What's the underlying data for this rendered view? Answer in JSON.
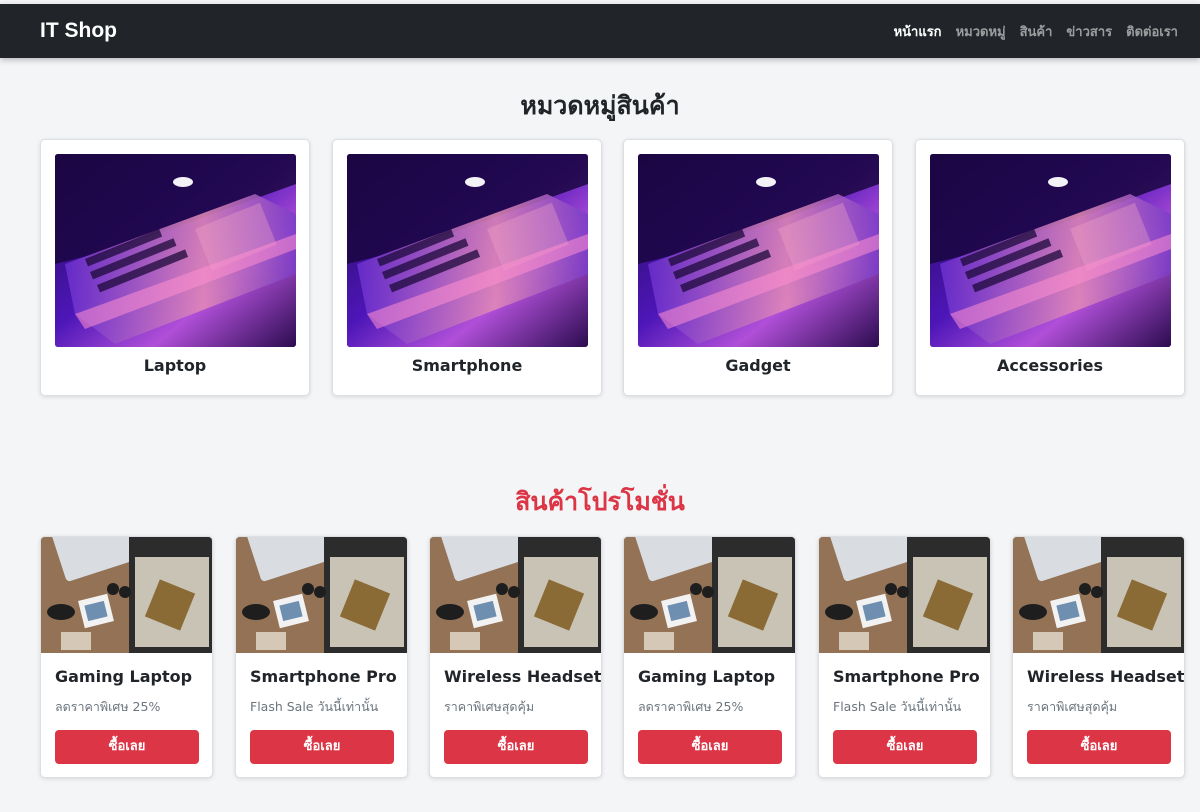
{
  "navbar": {
    "brand": "IT Shop",
    "links": [
      {
        "label": "หน้าแรก",
        "active": true
      },
      {
        "label": "หมวดหมู่",
        "active": false
      },
      {
        "label": "สินค้า",
        "active": false
      },
      {
        "label": "ข่าวสาร",
        "active": false
      },
      {
        "label": "ติดต่อเรา",
        "active": false
      }
    ]
  },
  "categories": {
    "title": "หมวดหมู่สินค้า",
    "items": [
      {
        "label": "Laptop"
      },
      {
        "label": "Smartphone"
      },
      {
        "label": "Gadget"
      },
      {
        "label": "Accessories"
      }
    ]
  },
  "promotions": {
    "title": "สินค้าโปรโมชั่น",
    "items": [
      {
        "name": "Gaming Laptop",
        "desc": "ลดราคาพิเศษ 25%",
        "button": "ซื้อเลย"
      },
      {
        "name": "Smartphone Pro",
        "desc": "Flash Sale วันนี้เท่านั้น",
        "button": "ซื้อเลย"
      },
      {
        "name": "Wireless Headset",
        "desc": "ราคาพิเศษสุดคุ้ม",
        "button": "ซื้อเลย"
      },
      {
        "name": "Gaming Laptop",
        "desc": "ลดราคาพิเศษ 25%",
        "button": "ซื้อเลย"
      },
      {
        "name": "Smartphone Pro",
        "desc": "Flash Sale วันนี้เท่านั้น",
        "button": "ซื้อเลย"
      },
      {
        "name": "Wireless Headset",
        "desc": "ราคาพิเศษสุดคุ้ม",
        "button": "ซื้อเลย"
      }
    ]
  },
  "colors": {
    "navbar_bg": "#212529",
    "accent": "#dc3545",
    "page_bg": "#f4f5f7"
  }
}
